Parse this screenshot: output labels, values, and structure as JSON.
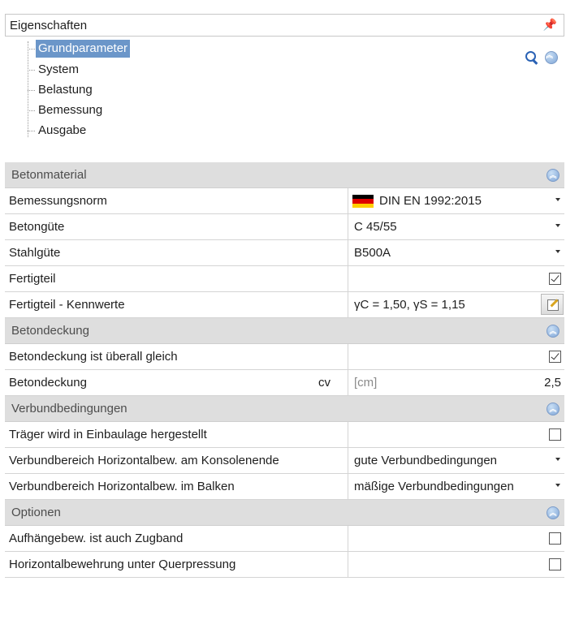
{
  "panel": {
    "title": "Eigenschaften",
    "pin_glyph": "↑"
  },
  "tree": {
    "items": [
      {
        "label": "Grundparameter",
        "selected": true
      },
      {
        "label": "System"
      },
      {
        "label": "Belastung"
      },
      {
        "label": "Bemessung"
      },
      {
        "label": "Ausgabe"
      }
    ]
  },
  "toolbar": {
    "search_icon": "search-icon",
    "collapse_icon": "collapse-all-icon"
  },
  "sections": {
    "betonmaterial": {
      "title": "Betonmaterial",
      "bemessungsnorm": {
        "label": "Bemessungsnorm",
        "value": "DIN EN 1992:2015"
      },
      "betonguete": {
        "label": "Betongüte",
        "value": "C 45/55"
      },
      "stahlguete": {
        "label": "Stahlgüte",
        "value": "B500A"
      },
      "fertigteil": {
        "label": "Fertigteil",
        "checked": true
      },
      "kennwerte": {
        "label": "Fertigteil - Kennwerte",
        "value": "γC = 1,50, γS = 1,15"
      }
    },
    "betondeckung": {
      "title": "Betondeckung",
      "gleich": {
        "label": "Betondeckung ist überall gleich",
        "checked": true
      },
      "deckung": {
        "label": "Betondeckung",
        "symbol": "cv",
        "unit": "[cm]",
        "value": "2,5"
      }
    },
    "verbund": {
      "title": "Verbundbedingungen",
      "einbaulage": {
        "label": "Träger wird in Einbaulage hergestellt",
        "checked": false
      },
      "konsole": {
        "label": "Verbundbereich Horizontalbew. am Konsolenende",
        "value": "gute Verbundbedingungen"
      },
      "balken": {
        "label": "Verbundbereich Horizontalbew. im Balken",
        "value": "mäßige Verbundbedingungen"
      }
    },
    "optionen": {
      "title": "Optionen",
      "zugband": {
        "label": "Aufhängebew. ist auch Zugband",
        "checked": false
      },
      "querpressung": {
        "label": "Horizontalbewehrung unter Querpressung",
        "checked": false
      }
    }
  },
  "colors": {
    "section_bg": "#dedede",
    "selection": "#6b96c9",
    "accent_blue": "#2a62b5",
    "flag": [
      "#000000",
      "#dd0000",
      "#ffce00"
    ]
  }
}
